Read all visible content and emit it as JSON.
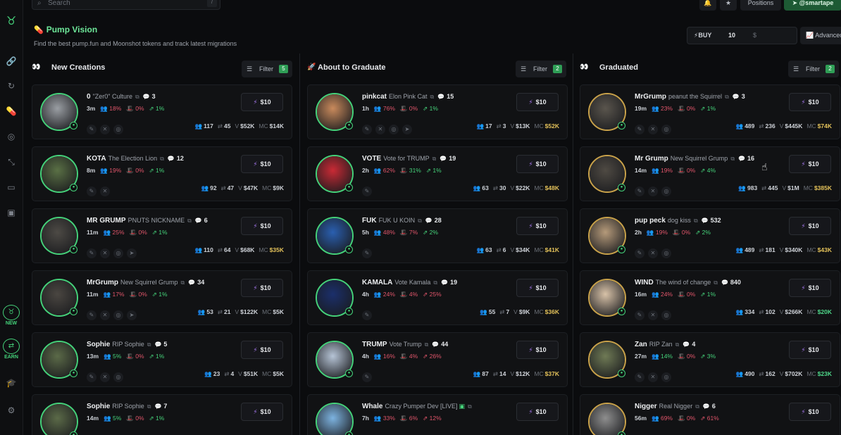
{
  "topbar": {
    "search_placeholder": "Search",
    "search_shortcut": "/",
    "positions_label": "Positions",
    "user_handle": "@smartape"
  },
  "header": {
    "title": "Pump Vision",
    "subtitle": "Find the best pump.fun and Moonshot tokens and track latest migrations",
    "buy_label": "BUY",
    "buy_amount": "10",
    "buy_unit": "$",
    "advanced_label": "Advanced"
  },
  "sidebar": {
    "new_label": "NEW",
    "earn_label": "EARN"
  },
  "colors": {
    "accent_green": "#45d27a",
    "danger_red": "#e0556a",
    "mc_yellow": "#e4c25a",
    "mc_green": "#4fd88a",
    "buy_icon_purple": "#a779f0"
  },
  "columns": [
    {
      "title": "New Creations",
      "filter_label": "Filter",
      "filter_count": "5",
      "cards": [
        {
          "symbol": "0",
          "name": "\"Zer0\" Culture",
          "msgs": "3",
          "age": "3m",
          "holders": "18%",
          "dev": "0%",
          "top": "1%",
          "holders_count": "117",
          "trades": "45",
          "volume": "$52K",
          "mc": "$14K",
          "socials": 3,
          "mc_color": "w",
          "avatar": "#9a9ea3",
          "stat_colors": [
            "r",
            "r",
            "g"
          ]
        },
        {
          "symbol": "KOTA",
          "name": "The Election Lion",
          "msgs": "12",
          "age": "8m",
          "holders": "19%",
          "dev": "0%",
          "top": "1%",
          "holders_count": "92",
          "trades": "47",
          "volume": "$47K",
          "mc": "$9K",
          "socials": 2,
          "mc_color": "w",
          "avatar": "#5a7045",
          "stat_colors": [
            "r",
            "r",
            "g"
          ]
        },
        {
          "symbol": "MR GRUMP",
          "name": "PNUTS NICKNAME",
          "msgs": "6",
          "age": "11m",
          "holders": "25%",
          "dev": "0%",
          "top": "1%",
          "holders_count": "110",
          "trades": "64",
          "volume": "$68K",
          "mc": "$35K",
          "socials": 4,
          "mc_color": "y",
          "avatar": "#4d4a45",
          "stat_colors": [
            "r",
            "r",
            "g"
          ]
        },
        {
          "symbol": "MrGrump",
          "name": "New Squirrel Grump",
          "msgs": "34",
          "age": "11m",
          "holders": "17%",
          "dev": "0%",
          "top": "1%",
          "holders_count": "53",
          "trades": "21",
          "volume": "$122K",
          "mc": "$5K",
          "socials": 4,
          "mc_color": "w",
          "avatar": "#4a4641",
          "stat_colors": [
            "r",
            "r",
            "g"
          ]
        },
        {
          "symbol": "Sophie",
          "name": "RIP Sophie",
          "msgs": "5",
          "age": "13m",
          "holders": "5%",
          "dev": "0%",
          "top": "1%",
          "holders_count": "23",
          "trades": "4",
          "volume": "$51K",
          "mc": "$5K",
          "socials": 3,
          "mc_color": "w",
          "avatar": "#5b6a48",
          "stat_colors": [
            "g",
            "r",
            "g"
          ]
        },
        {
          "symbol": "Sophie",
          "name": "RIP Sophie",
          "msgs": "7",
          "age": "14m",
          "holders": "5%",
          "dev": "0%",
          "top": "1%",
          "holders_count": "",
          "trades": "",
          "volume": "",
          "mc": "",
          "socials": 0,
          "mc_color": "w",
          "avatar": "#5b6a48",
          "stat_colors": [
            "g",
            "r",
            "g"
          ]
        }
      ]
    },
    {
      "title": "About to Graduate",
      "filter_label": "Filter",
      "filter_count": "2",
      "cards": [
        {
          "symbol": "pinkcat",
          "name": "Elon Pink Cat",
          "msgs": "15",
          "age": "1h",
          "holders": "76%",
          "dev": "0%",
          "top": "1%",
          "holders_count": "17",
          "trades": "3",
          "volume": "$13K",
          "mc": "$52K",
          "socials": 4,
          "mc_color": "y",
          "avatar": "#c98a5c",
          "stat_colors": [
            "r",
            "r",
            "g"
          ]
        },
        {
          "symbol": "VOTE",
          "name": "Vote for TRUMP",
          "msgs": "19",
          "age": "2h",
          "holders": "62%",
          "dev": "31%",
          "top": "1%",
          "holders_count": "63",
          "trades": "30",
          "volume": "$22K",
          "mc": "$48K",
          "socials": 1,
          "mc_color": "y",
          "avatar": "#c92a35",
          "stat_colors": [
            "r",
            "g",
            "g"
          ]
        },
        {
          "symbol": "FUK",
          "name": "FUK U KOIN",
          "msgs": "28",
          "age": "5h",
          "holders": "48%",
          "dev": "7%",
          "top": "2%",
          "holders_count": "63",
          "trades": "6",
          "volume": "$34K",
          "mc": "$41K",
          "socials": 1,
          "mc_color": "y",
          "avatar": "#2a5fb0",
          "stat_colors": [
            "r",
            "r",
            "g"
          ]
        },
        {
          "symbol": "KAMALA",
          "name": "Vote Kamala",
          "msgs": "19",
          "age": "4h",
          "holders": "24%",
          "dev": "4%",
          "top": "25%",
          "holders_count": "55",
          "trades": "7",
          "volume": "$9K",
          "mc": "$36K",
          "socials": 1,
          "mc_color": "y",
          "avatar": "#1b2f6b",
          "stat_colors": [
            "r",
            "r",
            "r"
          ]
        },
        {
          "symbol": "TRUMP",
          "name": "Vote Trump",
          "msgs": "44",
          "age": "4h",
          "holders": "16%",
          "dev": "4%",
          "top": "26%",
          "holders_count": "87",
          "trades": "14",
          "volume": "$12K",
          "mc": "$37K",
          "socials": 1,
          "mc_color": "y",
          "avatar": "#b6c4d6",
          "stat_colors": [
            "r",
            "r",
            "r"
          ]
        },
        {
          "symbol": "Whale",
          "name": "Crazy Pumper Dev [LIVE]",
          "msgs": "",
          "age": "7h",
          "holders": "33%",
          "dev": "6%",
          "top": "12%",
          "holders_count": "",
          "trades": "",
          "volume": "",
          "mc": "",
          "socials": 0,
          "mc_color": "y",
          "avatar": "#7db3e0",
          "stat_colors": [
            "r",
            "r",
            "r"
          ]
        }
      ]
    },
    {
      "title": "Graduated",
      "filter_label": "Filter",
      "filter_count": "2",
      "cards": [
        {
          "symbol": "MrGrump",
          "name": "peanut the Squirrel",
          "msgs": "3",
          "age": "19m",
          "holders": "23%",
          "dev": "0%",
          "top": "1%",
          "holders_count": "489",
          "trades": "236",
          "volume": "$445K",
          "mc": "$74K",
          "socials": 3,
          "mc_color": "y",
          "avatar": "#5a554d",
          "stat_colors": [
            "r",
            "r",
            "g"
          ]
        },
        {
          "symbol": "Mr Grump",
          "name": "New Squirrel Grump",
          "msgs": "16",
          "age": "14m",
          "holders": "19%",
          "dev": "0%",
          "top": "4%",
          "holders_count": "983",
          "trades": "445",
          "volume": "$1M",
          "mc": "$385K",
          "socials": 3,
          "mc_color": "y",
          "avatar": "#4f4a43",
          "stat_colors": [
            "r",
            "r",
            "g"
          ]
        },
        {
          "symbol": "pup peck",
          "name": "dog kiss",
          "msgs": "532",
          "age": "2h",
          "holders": "19%",
          "dev": "0%",
          "top": "2%",
          "holders_count": "489",
          "trades": "181",
          "volume": "$340K",
          "mc": "$43K",
          "socials": 3,
          "mc_color": "y",
          "avatar": "#b59a7a",
          "stat_colors": [
            "r",
            "r",
            "g"
          ]
        },
        {
          "symbol": "WIND",
          "name": "The wind of change",
          "msgs": "840",
          "age": "16m",
          "holders": "24%",
          "dev": "0%",
          "top": "1%",
          "holders_count": "334",
          "trades": "102",
          "volume": "$266K",
          "mc": "$20K",
          "socials": 3,
          "mc_color": "gr",
          "avatar": "#d8c2a8",
          "stat_colors": [
            "r",
            "r",
            "g"
          ]
        },
        {
          "symbol": "Zan",
          "name": "RIP Zan",
          "msgs": "4",
          "age": "27m",
          "holders": "14%",
          "dev": "0%",
          "top": "3%",
          "holders_count": "490",
          "trades": "162",
          "volume": "$702K",
          "mc": "$23K",
          "socials": 3,
          "mc_color": "gr",
          "avatar": "#6f7a55",
          "stat_colors": [
            "g",
            "r",
            "g"
          ]
        },
        {
          "symbol": "Nigger",
          "name": "Real Nigger",
          "msgs": "6",
          "age": "56m",
          "holders": "69%",
          "dev": "0%",
          "top": "61%",
          "holders_count": "",
          "trades": "",
          "volume": "",
          "mc": "",
          "socials": 0,
          "mc_color": "y",
          "avatar": "#8e8e8e",
          "stat_colors": [
            "r",
            "r",
            "r"
          ]
        }
      ]
    }
  ],
  "card_labels": {
    "buy_button": "$10",
    "volume_prefix": "V",
    "mc_prefix": "MC"
  }
}
